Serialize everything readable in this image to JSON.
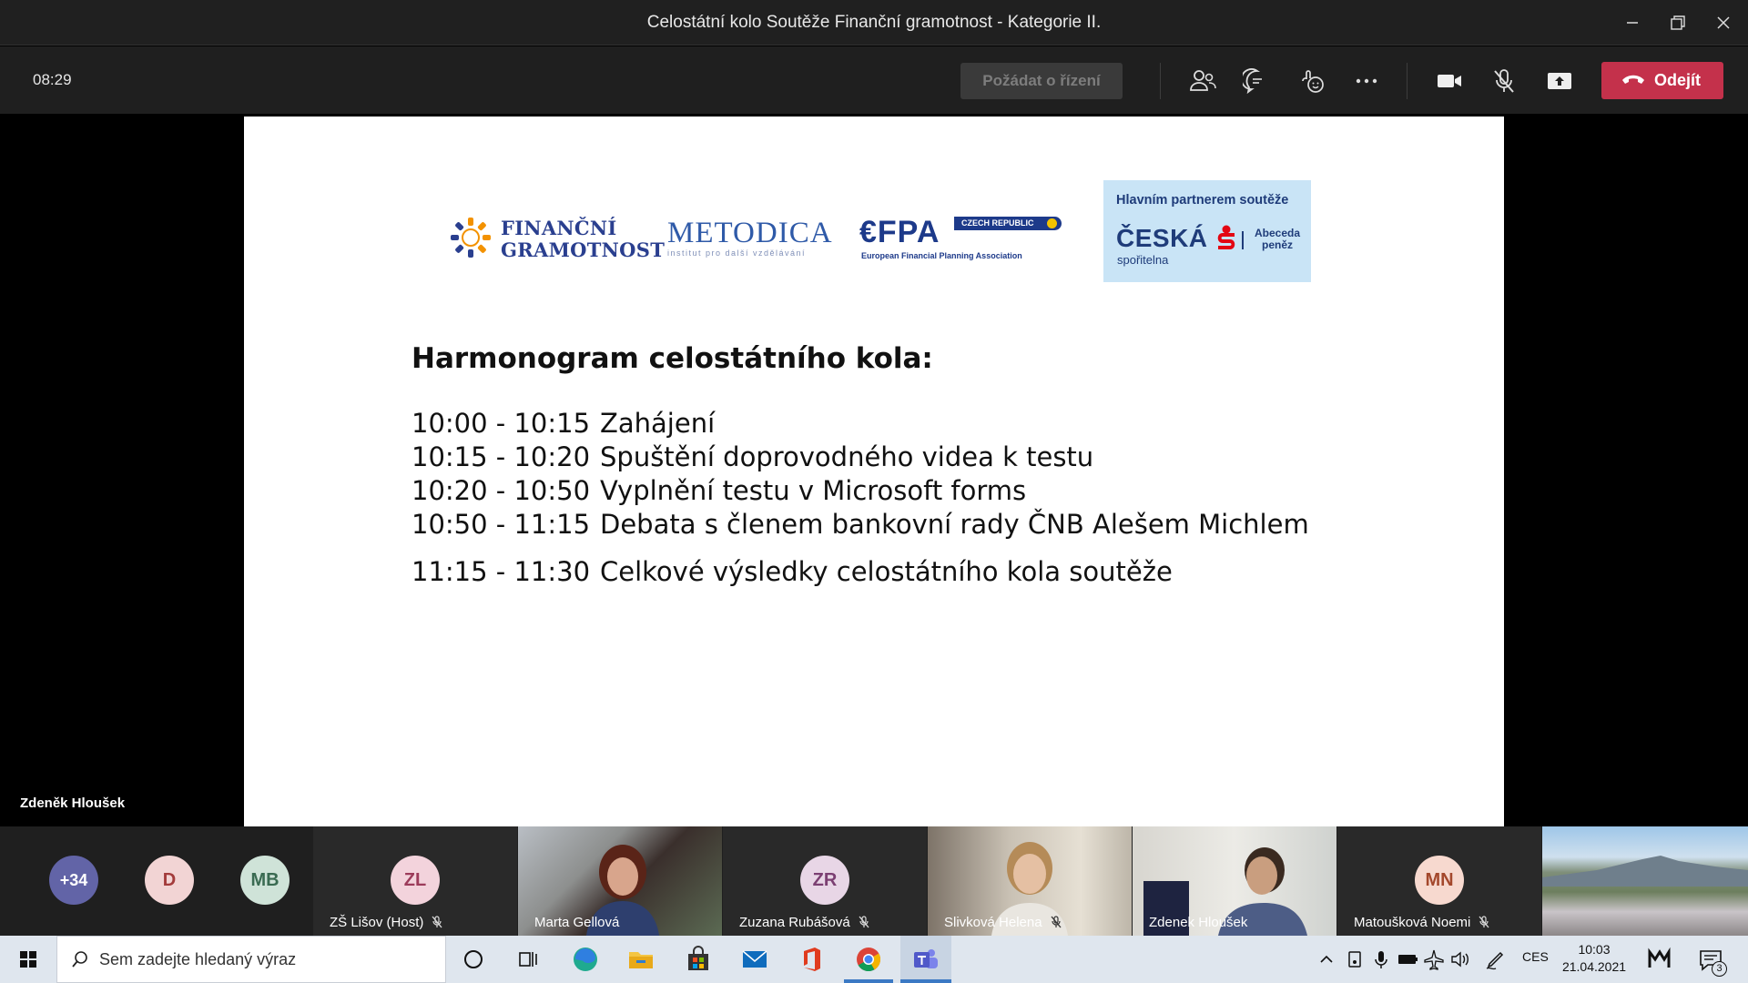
{
  "window": {
    "title": "Celostátní kolo Soutěže Finanční gramotnost - Kategorie II."
  },
  "meeting": {
    "timer": "08:29",
    "request_control_label": "Požádat o řízení",
    "leave_label": "Odejít",
    "presenter_name": "Zdeněk Hloušek"
  },
  "slide": {
    "logos": {
      "fg_line1": "FINANČNÍ",
      "fg_line2": "GRAMOTNOST",
      "metodica": "METODICA",
      "metodica_sub": "institut pro další vzdělávání",
      "efpa": "€FPA",
      "efpa_tag": "CZECH REPUBLIC",
      "efpa_sub": "European Financial Planning Association",
      "partner_heading": "Hlavním partnerem soutěže",
      "partner_name": "ČESKÁ",
      "partner_sub": "spořitelna",
      "partner_tagline_1": "Abeceda",
      "partner_tagline_2": "peněz"
    },
    "heading": "Harmonogram celostátního kola:",
    "schedule": [
      {
        "time": "10:00 - 10:15",
        "item": "Zahájení"
      },
      {
        "time": "10:15 - 10:20",
        "item": "Spuštění doprovodného videa k testu"
      },
      {
        "time": "10:20 - 10:50",
        "item": "Vyplnění testu v Microsoft forms"
      },
      {
        "time": "10:50 - 11:15",
        "item": "Debata s členem bankovní rady ČNB Alešem Michlem"
      },
      {
        "time": "11:15 - 11:30",
        "item": "Celkové výsledky celostátního kola soutěže"
      }
    ]
  },
  "participants": {
    "more_count": "+34",
    "avatars": [
      {
        "initials": "D",
        "bg": "#f2d4d4",
        "fg": "#a33b3b"
      },
      {
        "initials": "MB",
        "bg": "#cfe3d8",
        "fg": "#3a6b52"
      }
    ],
    "tiles": [
      {
        "initials": "ZL",
        "name": "ZŠ Lišov (Host)",
        "muted": true
      },
      {
        "initials": "",
        "name": "Marta Gellová",
        "muted": false
      },
      {
        "initials": "ZR",
        "name": "Zuzana Rubášová",
        "muted": true
      },
      {
        "initials": "",
        "name": "Slivková Helena",
        "muted": true
      },
      {
        "initials": "",
        "name": "Zdenek Hloušek",
        "muted": false
      },
      {
        "initials": "MN",
        "name": "Matoušková Noemi",
        "muted": true
      }
    ]
  },
  "taskbar": {
    "search_placeholder": "Sem zadejte hledaný výraz",
    "language": "CES",
    "time": "10:03",
    "date": "21.04.2021",
    "notifications": "3"
  },
  "colors": {
    "leave": "#c4314b",
    "teams_purple": "#6264a7",
    "slide_text": "#111111"
  }
}
